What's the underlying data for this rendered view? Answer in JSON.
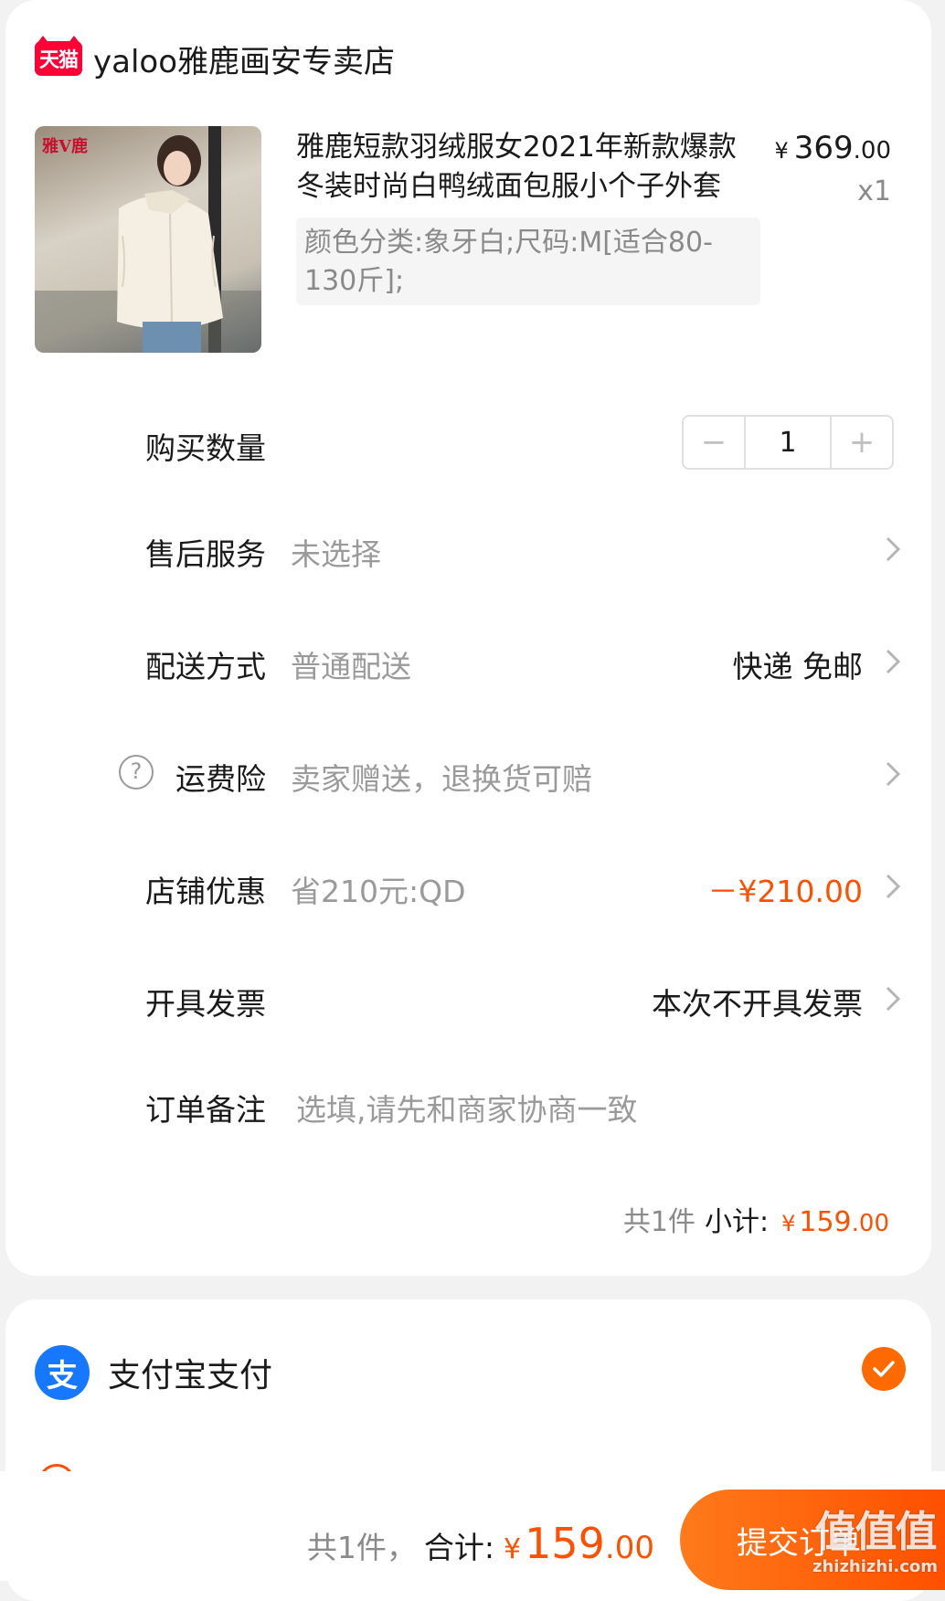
{
  "store": {
    "logo_text": "天猫",
    "name": "yaloo雅鹿画安专卖店"
  },
  "product": {
    "image_brand": "雅V鹿",
    "title": "雅鹿短款羽绒服女2021年新款爆款冬装时尚白鸭绒面包服小个子外套",
    "sku": "颜色分类:象牙白;尺码:M[适合80-130斤];",
    "price_symbol": "¥",
    "price_int": "369",
    "price_dec": ".00",
    "quantity_text": "x1"
  },
  "rows": {
    "quantity": {
      "label": "购买数量",
      "minus": "−",
      "value": "1",
      "plus": "+"
    },
    "aftersale": {
      "label": "售后服务",
      "value": "未选择"
    },
    "delivery": {
      "label": "配送方式",
      "value": "普通配送",
      "right": "快递 免邮"
    },
    "shipping_insurance": {
      "help": "?",
      "label": "运费险",
      "value": "卖家赠送，退换货可赔"
    },
    "store_discount": {
      "label": "店铺优惠",
      "value": "省210元:QD",
      "right": "－¥210.00"
    },
    "invoice": {
      "label": "开具发票",
      "right": "本次不开具发票"
    },
    "remark": {
      "label": "订单备注",
      "placeholder": "选填,请先和商家协商一致"
    }
  },
  "subtotal": {
    "count": "共1件",
    "label": "小计:",
    "symbol": "¥",
    "int": "159",
    "dec": ".00"
  },
  "payment": {
    "method_icon": "支",
    "method_label": "支付宝支付"
  },
  "bottom_bar": {
    "count": "共1件，",
    "label": "合计:",
    "symbol": "¥",
    "int": "159",
    "dec": ".00",
    "submit": "提交订单"
  },
  "watermark": {
    "logo": "值值值",
    "site": "zhizhizhi.com"
  },
  "colors": {
    "accent": "#ff5000",
    "alipay": "#1677ff",
    "tmall": "#ff0036"
  }
}
